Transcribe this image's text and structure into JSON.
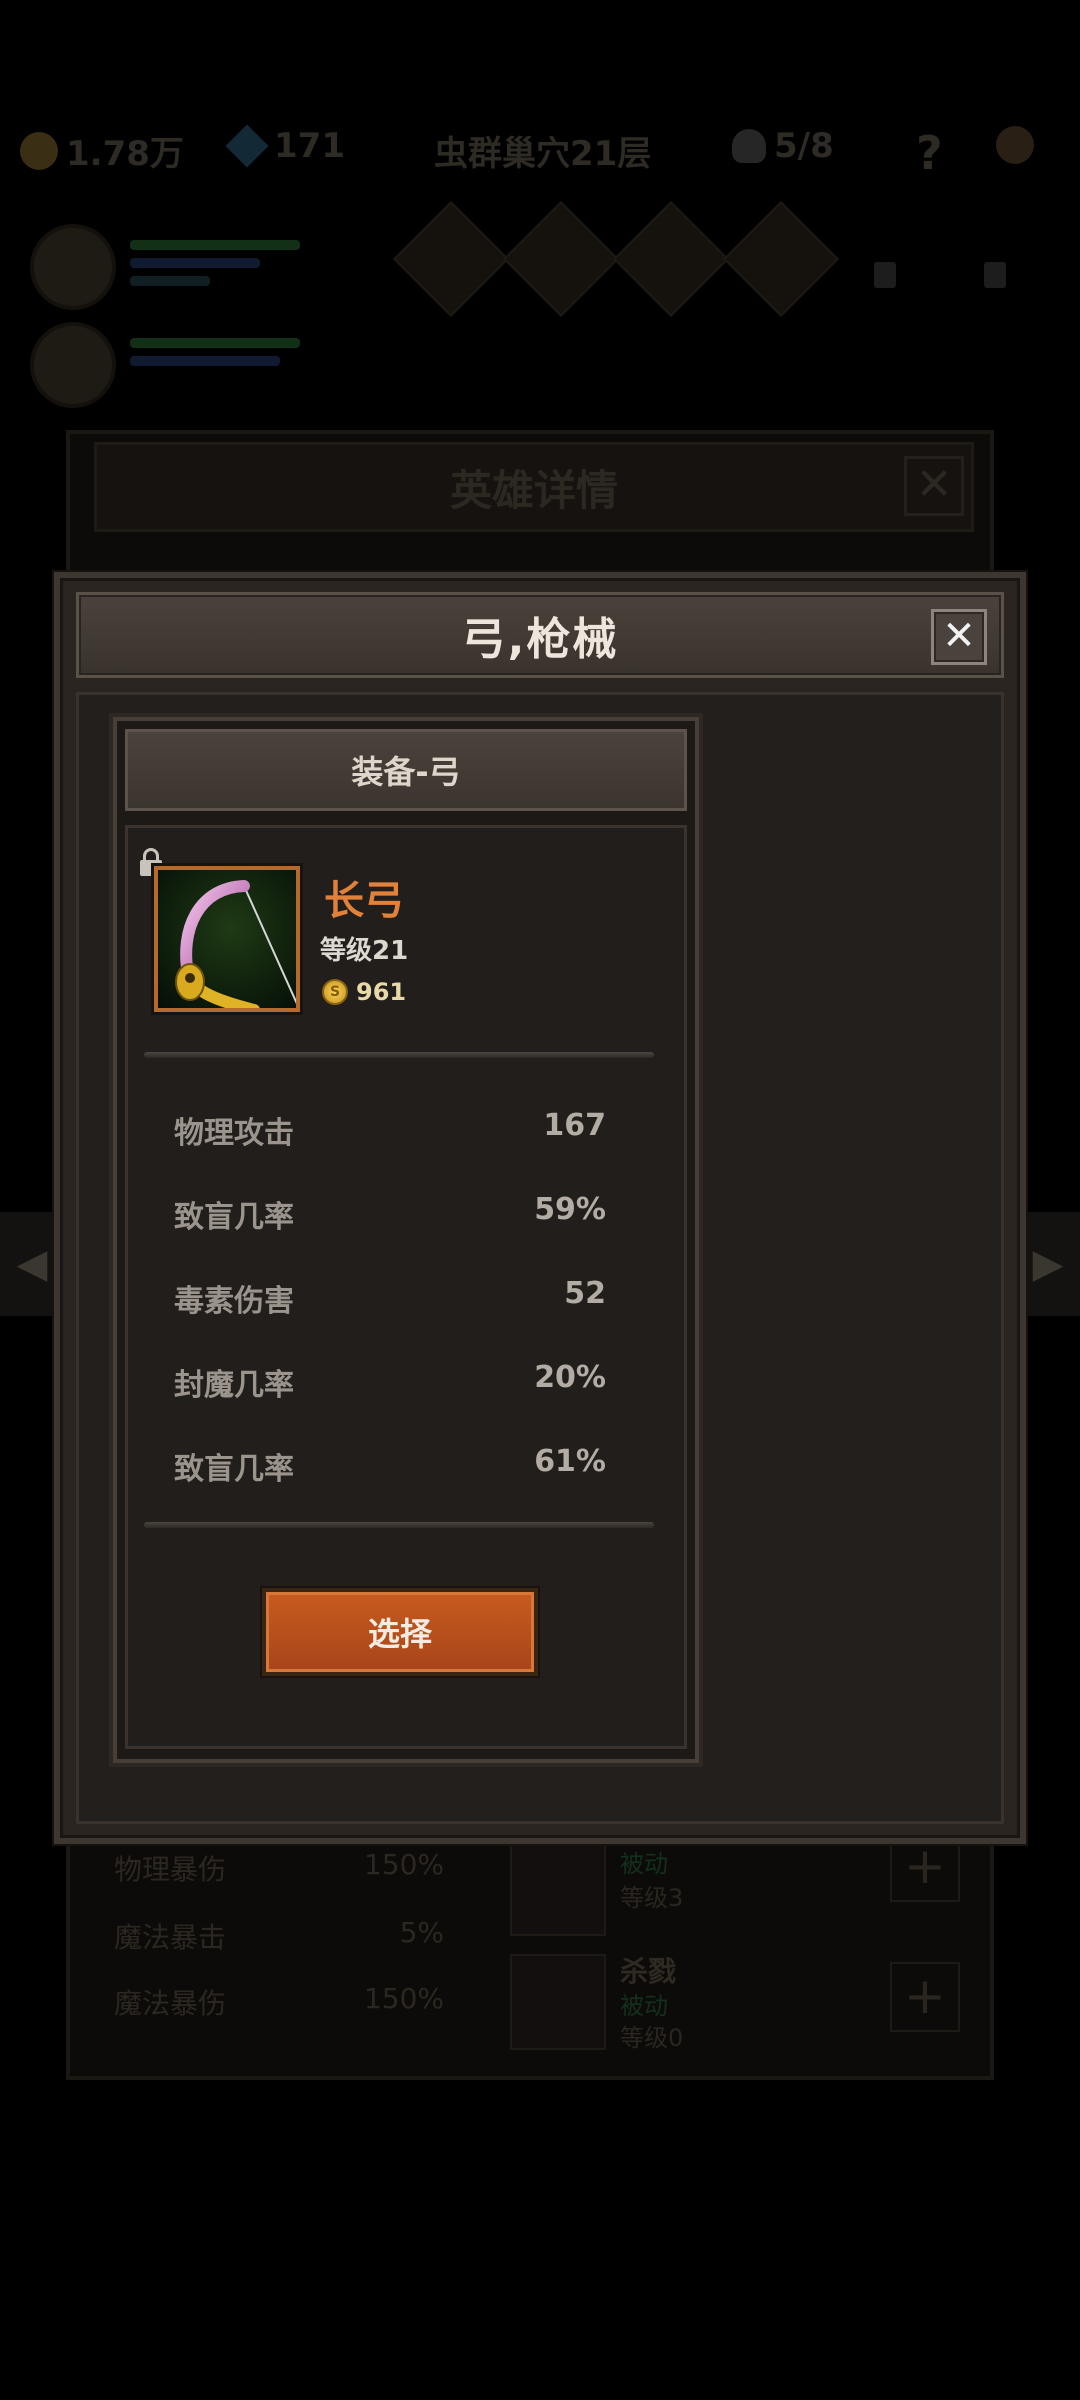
{
  "background": {
    "topbar": {
      "gold": "1.78万",
      "gems": "171",
      "location": "虫群巢穴21层",
      "skulls": "5/8",
      "help": "?"
    },
    "panel": {
      "title": "英雄详情",
      "close": "✕",
      "stats": [
        {
          "name": "物理暴伤",
          "value": "150%"
        },
        {
          "name": "魔法暴击",
          "value": "5%"
        },
        {
          "name": "魔法暴伤",
          "value": "150%"
        }
      ],
      "skills": [
        {
          "name": "",
          "type": "被动",
          "level": "等级3"
        },
        {
          "name": "杀戮",
          "type": "被动",
          "level": "等级0"
        }
      ],
      "add_label": "+"
    },
    "nav_left": "◀",
    "nav_right": "▶"
  },
  "modal": {
    "title": "弓,枪械",
    "close": "✕",
    "card": {
      "header": "装备-弓",
      "item": {
        "name": "长弓",
        "level": "等级21",
        "price": "961",
        "coin_symbol": "S"
      },
      "stats": [
        {
          "name": "物理攻击",
          "value": "167"
        },
        {
          "name": "致盲几率",
          "value": "59%"
        },
        {
          "name": "毒素伤害",
          "value": "52"
        },
        {
          "name": "封魔几率",
          "value": "20%"
        },
        {
          "name": "致盲几率",
          "value": "61%"
        }
      ],
      "select_label": "选择"
    }
  },
  "colors": {
    "item_name": "#e2823a",
    "frame_rarity": "#b36a2c",
    "button": "#c85c1e"
  }
}
